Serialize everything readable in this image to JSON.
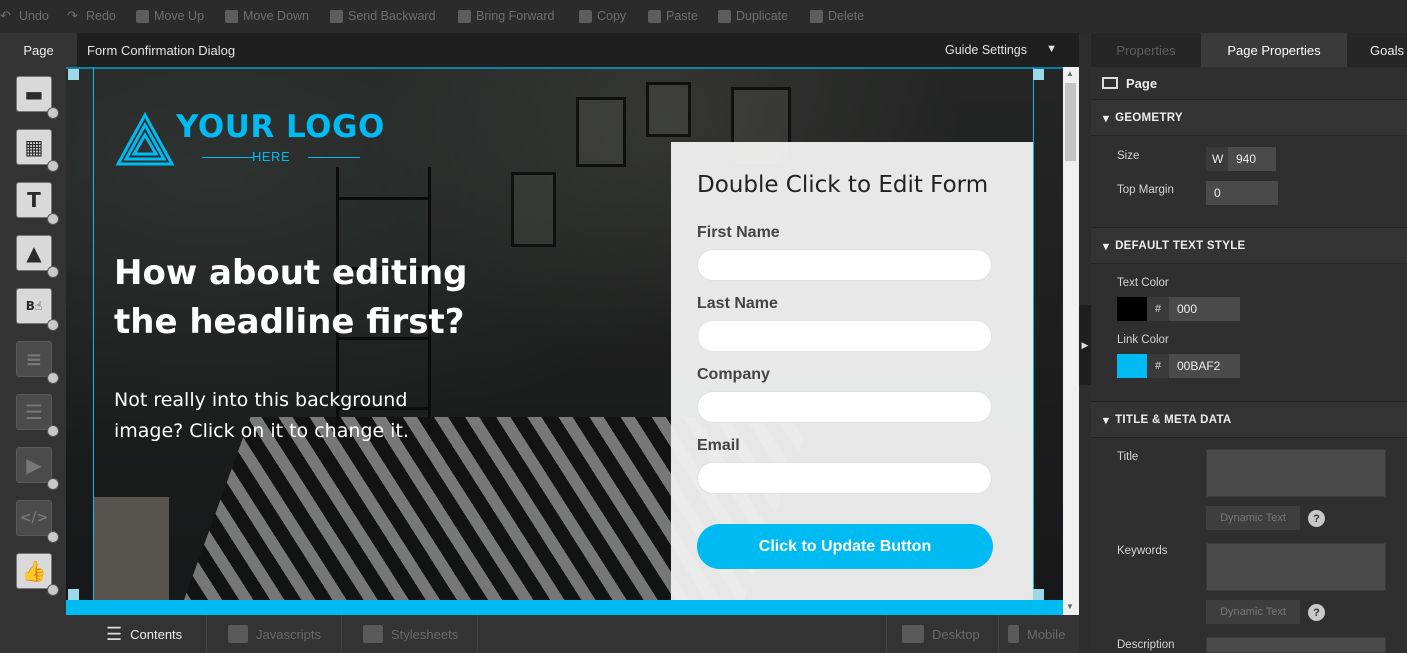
{
  "toolbar": {
    "undo": "Undo",
    "redo": "Redo",
    "move_up": "Move Up",
    "move_down": "Move Down",
    "send_backward": "Send Backward",
    "bring_forward": "Bring Forward",
    "copy": "Copy",
    "paste": "Paste",
    "duplicate": "Duplicate",
    "delete": "Delete"
  },
  "header": {
    "page_tab": "Page",
    "doc_title": "Form Confirmation Dialog",
    "guide_settings": "Guide Settings"
  },
  "canvas": {
    "logo_text": "YOUR LOGO",
    "logo_sub": "HERE",
    "headline": "How about editing the headline first?",
    "subtext": "Not really into this background image? Click on it to change it.",
    "accent_color": "#00baf2"
  },
  "form": {
    "title": "Double Click to Edit Form",
    "fields": [
      "First Name",
      "Last Name",
      "Company",
      "Email"
    ],
    "button": "Click to Update Button"
  },
  "bottom_tabs": {
    "contents": "Contents",
    "javascripts": "Javascripts",
    "stylesheets": "Stylesheets",
    "desktop": "Desktop",
    "mobile": "Mobile"
  },
  "right_panel": {
    "tabs": [
      "Properties",
      "Page Properties",
      "Goals"
    ],
    "active_tab": "Page Properties",
    "page_label": "Page",
    "geometry": {
      "heading": "GEOMETRY",
      "size_label": "Size",
      "size_prefix": "W",
      "size_value": "940",
      "top_margin_label": "Top Margin",
      "top_margin_value": "0"
    },
    "text_style": {
      "heading": "DEFAULT TEXT STYLE",
      "text_color_label": "Text Color",
      "text_color_value": "000",
      "text_color": "#000000",
      "link_color_label": "Link Color",
      "link_color_value": "00BAF2",
      "link_color": "#00baf2",
      "hash": "#"
    },
    "meta": {
      "heading": "TITLE & META DATA",
      "title_label": "Title",
      "keywords_label": "Keywords",
      "description_label": "Description",
      "dynamic_text": "Dynamic Text",
      "help": "?"
    }
  }
}
